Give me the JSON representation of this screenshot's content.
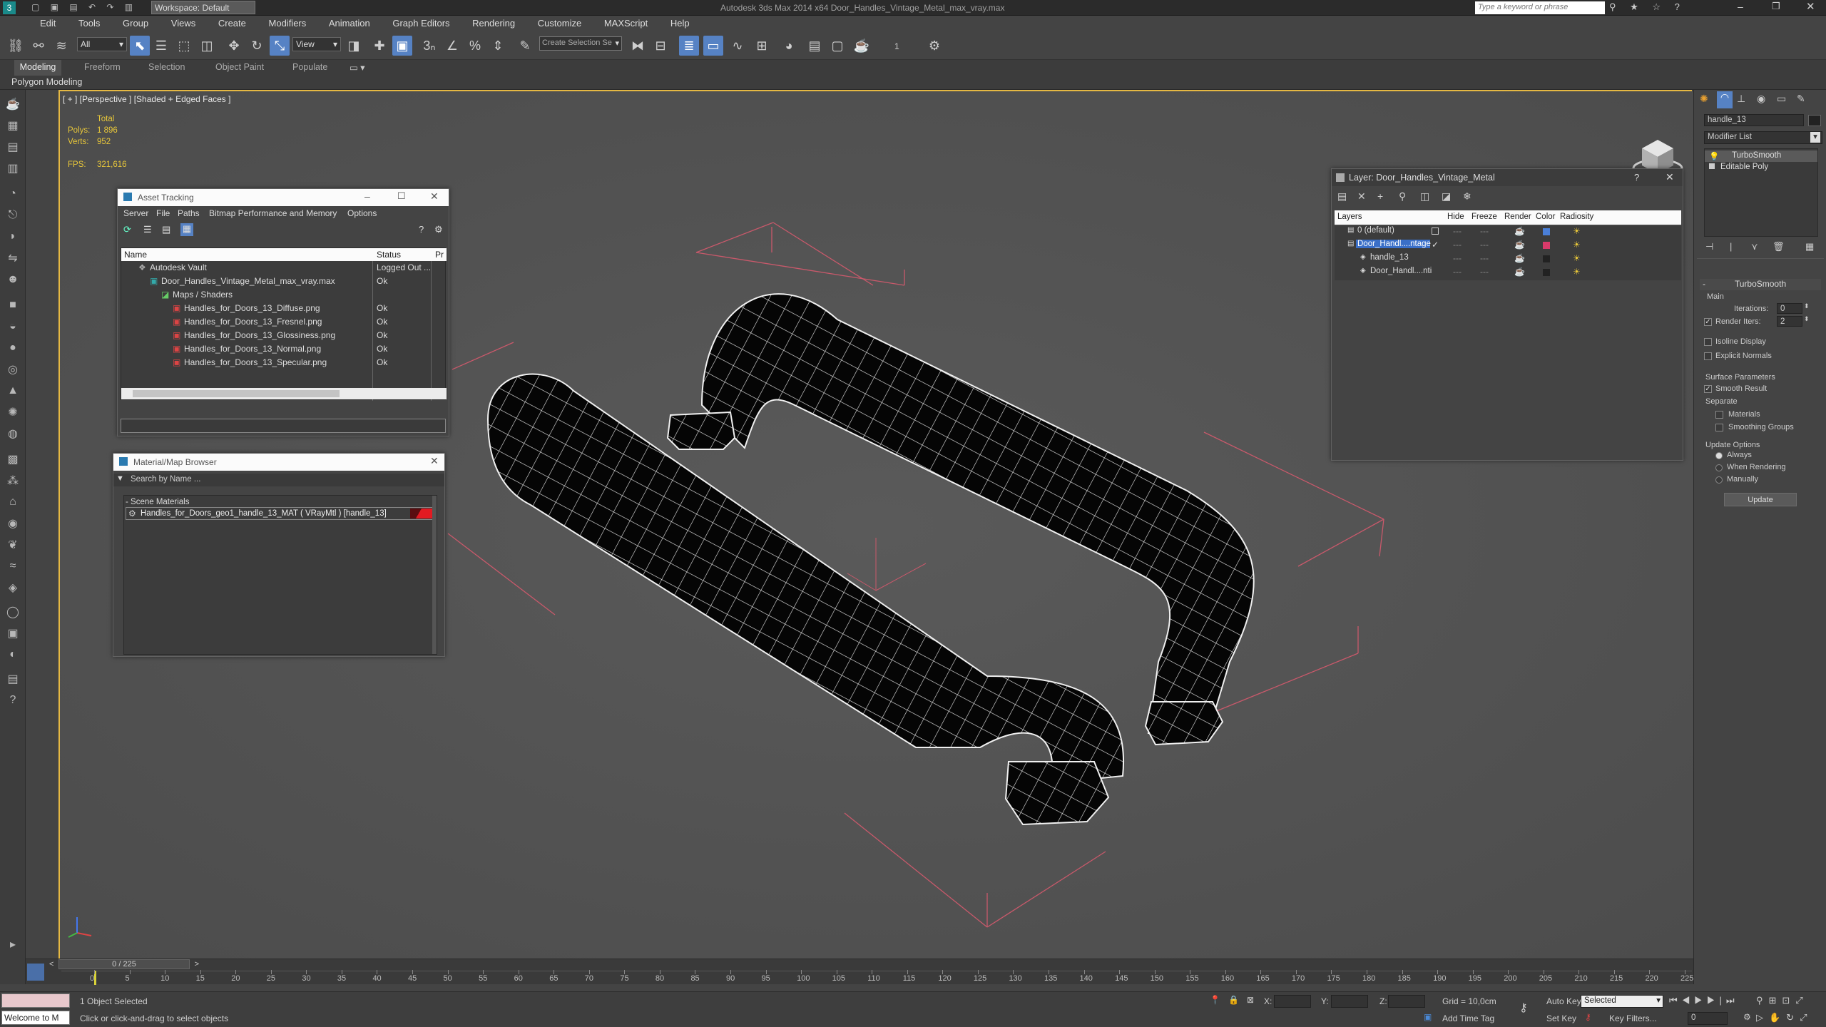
{
  "app": {
    "window_title": "Autodesk 3ds Max 2014 x64    Door_Handles_Vintage_Metal_max_vray.max",
    "workspace": "Workspace: Default",
    "search_placeholder": "Type a keyword or phrase"
  },
  "menu": [
    "Edit",
    "Tools",
    "Group",
    "Views",
    "Create",
    "Modifiers",
    "Animation",
    "Graph Editors",
    "Rendering",
    "Customize",
    "MAXScript",
    "Help"
  ],
  "toolbar": {
    "filter_value": "All",
    "ref_coord": "View",
    "selection_set_placeholder": "Create Selection Se",
    "counter": "1"
  },
  "ribbon": {
    "tabs": [
      "Modeling",
      "Freeform",
      "Selection",
      "Object Paint",
      "Populate"
    ],
    "sub_label": "Polygon Modeling"
  },
  "viewport": {
    "label": "[ + ] [Perspective ] [Shaded + Edged Faces ]",
    "stats": {
      "total_label": "Total",
      "polys_label": "Polys:",
      "polys_value": "1 896",
      "verts_label": "Verts:",
      "verts_value": "952",
      "fps_label": "FPS:",
      "fps_value": "321,616"
    }
  },
  "asset_tracking": {
    "title": "Asset Tracking",
    "menu": [
      "Server",
      "File",
      "Paths",
      "Bitmap Performance and Memory",
      "Options"
    ],
    "columns": [
      "Name",
      "Status",
      "Pr"
    ],
    "rows": [
      {
        "name": "Autodesk Vault",
        "status": "Logged Out ..."
      },
      {
        "name": "Door_Handles_Vintage_Metal_max_vray.max",
        "status": "Ok"
      },
      {
        "name": "Maps / Shaders",
        "status": ""
      },
      {
        "name": "Handles_for_Doors_13_Diffuse.png",
        "status": "Ok"
      },
      {
        "name": "Handles_for_Doors_13_Fresnel.png",
        "status": "Ok"
      },
      {
        "name": "Handles_for_Doors_13_Glossiness.png",
        "status": "Ok"
      },
      {
        "name": "Handles_for_Doors_13_Normal.png",
        "status": "Ok"
      },
      {
        "name": "Handles_for_Doors_13_Specular.png",
        "status": "Ok"
      }
    ]
  },
  "material_browser": {
    "title": "Material/Map Browser",
    "search_placeholder": "Search by Name ...",
    "group": "- Scene Materials",
    "item": "Handles_for_Doors_geo1_handle_13_MAT ( VRayMtl ) [handle_13]"
  },
  "layer_dialog": {
    "title": "Layer: Door_Handles_Vintage_Metal",
    "columns": [
      "Layers",
      "Hide",
      "Freeze",
      "Render",
      "Color",
      "Radiosity"
    ],
    "rows": [
      {
        "name": "0 (default)",
        "color": "#4a7fd8"
      },
      {
        "name": "Door_Handl....ntage",
        "color": "#d83a6a"
      },
      {
        "name": "handle_13",
        "color": "#222222"
      },
      {
        "name": "Door_Handl....nti",
        "color": "#222222"
      }
    ]
  },
  "command_panel": {
    "object_name": "handle_13",
    "modifier_list": "Modifier List",
    "stack": [
      "TurboSmooth",
      "Editable Poly"
    ],
    "rollout_title": "TurboSmooth",
    "main_label": "Main",
    "iterations_label": "Iterations:",
    "iterations_value": "0",
    "render_iters_label": "Render Iters:",
    "render_iters_value": "2",
    "isoline": "Isoline Display",
    "explicit": "Explicit Normals",
    "surface_params": "Surface Parameters",
    "smooth_result": "Smooth Result",
    "separate": "Separate",
    "materials": "Materials",
    "smoothing_groups": "Smoothing Groups",
    "update_options": "Update Options",
    "always": "Always",
    "when_rendering": "When Rendering",
    "manually": "Manually",
    "update_button": "Update"
  },
  "timeline": {
    "frame_counter": "0 / 225",
    "ticks": [
      "0",
      "5",
      "10",
      "15",
      "20",
      "25",
      "30",
      "35",
      "40",
      "45",
      "50",
      "55",
      "60",
      "65",
      "70",
      "75",
      "80",
      "85",
      "90",
      "95",
      "100",
      "105",
      "110",
      "115",
      "120",
      "125",
      "130",
      "135",
      "140",
      "145",
      "150",
      "155",
      "160",
      "165",
      "170",
      "175",
      "180",
      "185",
      "190",
      "195",
      "200",
      "205",
      "210",
      "215",
      "220",
      "225"
    ]
  },
  "status": {
    "maxscript": "Welcome to M",
    "selected": "1 Object Selected",
    "hint": "Click or click-and-drag to select objects",
    "x_label": "X:",
    "y_label": "Y:",
    "z_label": "Z:",
    "grid": "Grid = 10,0cm",
    "add_time_tag": "Add Time Tag",
    "auto_key": "Auto Key",
    "set_key": "Set Key",
    "selected_dropdown": "Selected",
    "key_filters": "Key Filters...",
    "frame_value": "0"
  }
}
